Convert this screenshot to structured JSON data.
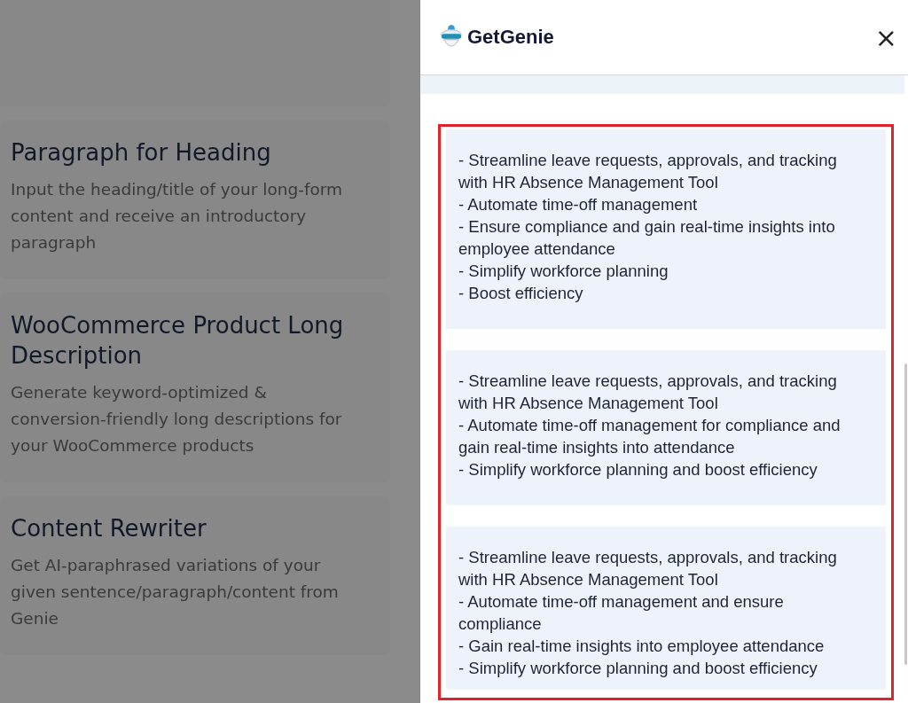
{
  "templates": [
    {
      "title": "Paragraph for Heading",
      "description": "Input the heading/title of your long-form content and receive an introductory paragraph"
    },
    {
      "title": "WooCommerce Product Long Description",
      "description": "Generate keyword-optimized & conversion-friendly long descriptions for your WooCommerce products"
    },
    {
      "title": "Content Rewriter",
      "description": "Get AI-paraphrased variations of your given sentence/paragraph/content from Genie"
    }
  ],
  "panel": {
    "logo": "GetGenie",
    "close": "×",
    "results": [
      {
        "lines": [
          "- Streamline leave requests, approvals, and tracking with HR Absence Management Tool",
          "- Automate time-off management",
          "- Ensure compliance and gain real-time insights into employee attendance",
          "- Simplify workforce planning",
          "- Boost efficiency"
        ]
      },
      {
        "lines": [
          "- Streamline leave requests, approvals, and tracking with HR Absence Management Tool",
          "- Automate time-off management for compliance and gain real-time insights into attendance",
          "- Simplify workforce planning and boost efficiency"
        ]
      },
      {
        "lines": [
          "- Streamline leave requests, approvals, and tracking with HR Absence Management Tool",
          "- Automate time-off management and ensure compliance",
          "- Gain real-time insights into employee attendance",
          "- Simplify workforce planning and boost efficiency"
        ]
      }
    ]
  }
}
